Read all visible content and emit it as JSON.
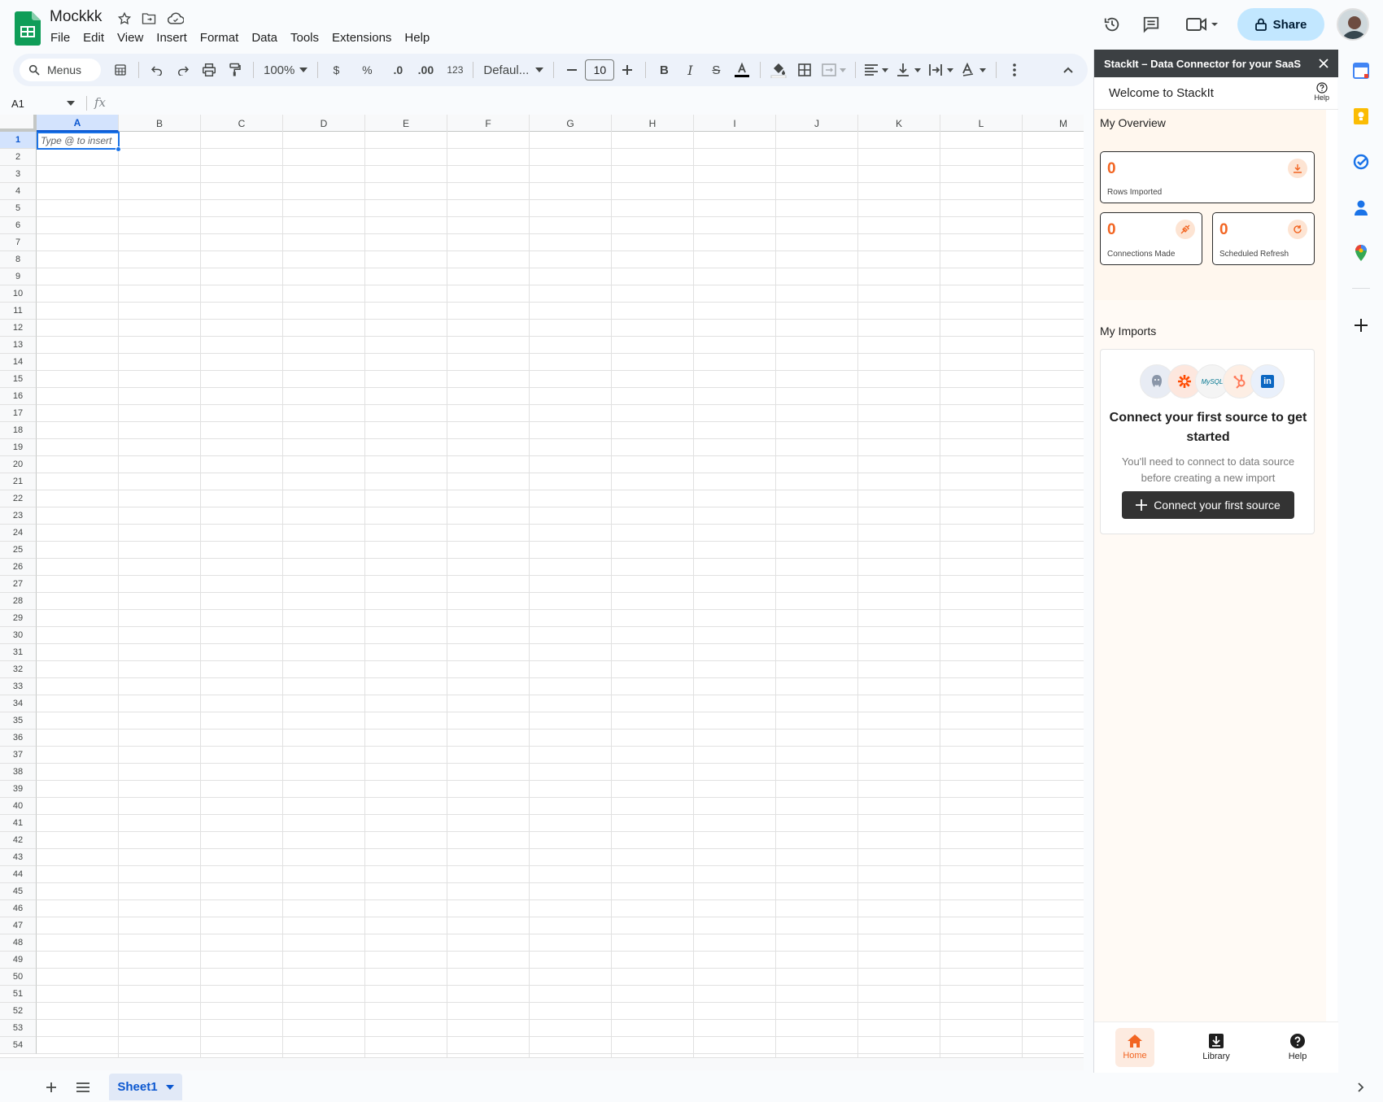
{
  "doc": {
    "title": "Mockkk"
  },
  "menus": [
    "File",
    "Edit",
    "View",
    "Insert",
    "Format",
    "Data",
    "Tools",
    "Extensions",
    "Help"
  ],
  "header": {
    "share_label": "Share"
  },
  "toolbar": {
    "menus_label": "Menus",
    "zoom": "100%",
    "currency": "$",
    "percent": "%",
    "decrease_decimal": ".0",
    "increase_decimal": ".00",
    "number_format": "123",
    "font": "Defaul...",
    "font_size": "10"
  },
  "formula_bar": {
    "cell_ref": "A1",
    "fx": "fx"
  },
  "grid": {
    "columns": [
      "A",
      "B",
      "C",
      "D",
      "E",
      "F",
      "G",
      "H",
      "I",
      "J",
      "K",
      "L",
      "M"
    ],
    "rows": [
      "1",
      "2",
      "3",
      "4",
      "5",
      "6",
      "7",
      "8",
      "9",
      "10",
      "11",
      "12",
      "13",
      "14",
      "15",
      "16",
      "17",
      "18",
      "19",
      "20",
      "21",
      "22",
      "23",
      "24",
      "25",
      "26",
      "27",
      "28",
      "29",
      "30",
      "31",
      "32",
      "33",
      "34",
      "35",
      "36",
      "37",
      "38",
      "39",
      "40",
      "41",
      "42",
      "43",
      "44",
      "45",
      "46",
      "47",
      "48",
      "49",
      "50",
      "51",
      "52",
      "53",
      "54"
    ],
    "active_cell_hint": "Type @ to insert",
    "selected_column": "A",
    "selected_row": "1"
  },
  "sheets": {
    "active": "Sheet1"
  },
  "panel": {
    "title": "StackIt – Data Connector for your SaaS",
    "welcome": "Welcome to StackIt",
    "help_label": "Help",
    "overview_title": "My Overview",
    "stats": [
      {
        "value": "0",
        "label": "Rows Imported",
        "icon": "download-icon"
      },
      {
        "value": "0",
        "label": "Connections Made",
        "icon": "plug-icon"
      },
      {
        "value": "0",
        "label": "Scheduled Refresh",
        "icon": "refresh-icon"
      }
    ],
    "imports_title": "My Imports",
    "logos": [
      "postgresql-logo",
      "zapier-logo",
      "mysql-logo",
      "hubspot-logo",
      "linkedin-logo"
    ],
    "mysql_text": "MySQL",
    "linkedin_text": "in",
    "imports_heading": "Connect your first source to get started",
    "imports_sub": "You'll need to connect to data source before creating a new import",
    "connect_button": "Connect your first source",
    "nav": [
      {
        "label": "Home",
        "icon": "home-icon",
        "active": true
      },
      {
        "label": "Library",
        "icon": "library-icon",
        "active": false
      },
      {
        "label": "Help",
        "icon": "help-icon",
        "active": false
      }
    ]
  },
  "colors": {
    "accent": "#f26522",
    "sheets_green": "#0f9d58",
    "selection_blue": "#0b57d0",
    "share_bg": "#c2e7ff"
  }
}
